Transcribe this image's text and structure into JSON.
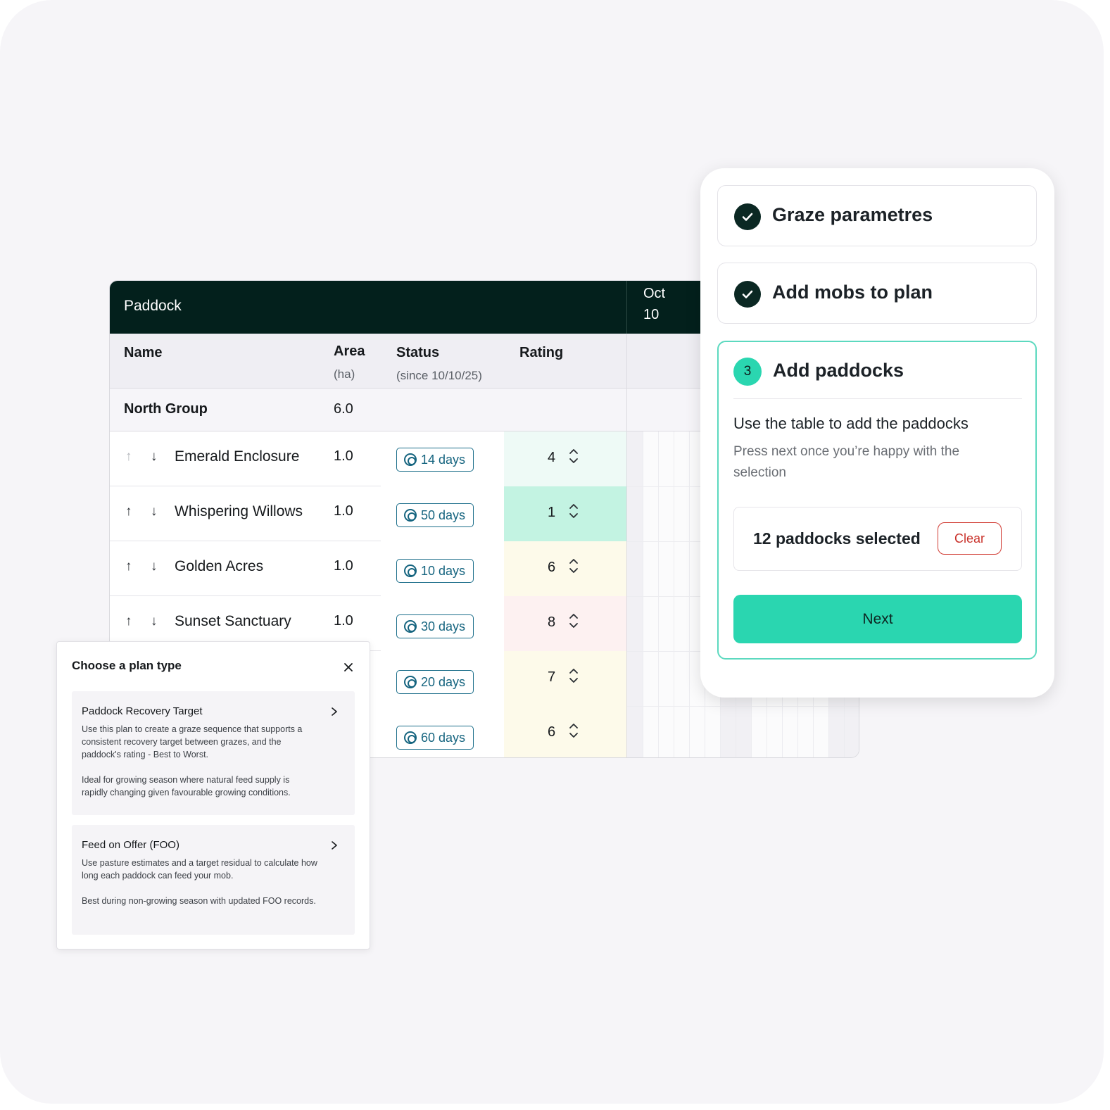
{
  "table": {
    "header_title": "Paddock",
    "date_month": "Oct",
    "date_day": "10",
    "columns": {
      "name": "Name",
      "area": "Area",
      "area_unit": "(ha)",
      "status": "Status",
      "status_sub": "(since 10/10/25)",
      "rating": "Rating"
    },
    "group": {
      "name": "North Group",
      "area": "6.0"
    },
    "rows": [
      {
        "name": "Emerald Enclosure",
        "area": "1.0",
        "status": "14 days",
        "rating": "4"
      },
      {
        "name": "Whispering Willows",
        "area": "1.0",
        "status": "50 days",
        "rating": "1"
      },
      {
        "name": "Golden Acres",
        "area": "1.0",
        "status": "10 days",
        "rating": "6"
      },
      {
        "name": "Sunset Sanctuary",
        "area": "1.0",
        "status": "30 days",
        "rating": "8"
      },
      {
        "name": "",
        "area": "",
        "status": "20 days",
        "rating": "7"
      },
      {
        "name": "",
        "area": "",
        "status": "60 days",
        "rating": "6"
      }
    ],
    "rating_colors": [
      "#eefaf6",
      "#c3f3e2",
      "#fdfaea",
      "#fdf1f1",
      "#fdfaea",
      "#fdfaea"
    ],
    "arrow_up_glyph": "↑",
    "arrow_down_glyph": "↓"
  },
  "plan_type": {
    "title": "Choose a plan type",
    "options": [
      {
        "title": "Paddock Recovery Target",
        "text1": "Use this plan to create a graze sequence that supports a consistent recovery target between grazes, and the paddock's rating - Best to Worst.",
        "text2": "Ideal for growing season where natural feed supply is rapidly changing given favourable growing conditions."
      },
      {
        "title": "Feed on Offer (FOO)",
        "text1": "Use pasture estimates and a target residual to calculate how long each paddock can feed your mob.",
        "text2": "Best during non-growing season with updated FOO records."
      }
    ]
  },
  "stepper": {
    "steps": [
      {
        "title": "Graze parametres",
        "state": "done"
      },
      {
        "title": "Add mobs to plan",
        "state": "done"
      },
      {
        "number": "3",
        "title": "Add paddocks",
        "state": "active"
      }
    ],
    "instruction": "Use the table to add the paddocks",
    "help": "Press next once you’re happy with the selection",
    "selected_count": "12 paddocks selected",
    "clear_label": "Clear",
    "next_label": "Next"
  },
  "colors": {
    "header_dark": "#03201c",
    "accent_teal": "#2ad6b0",
    "status_blue": "#15647f",
    "danger_red": "#c9322b"
  }
}
